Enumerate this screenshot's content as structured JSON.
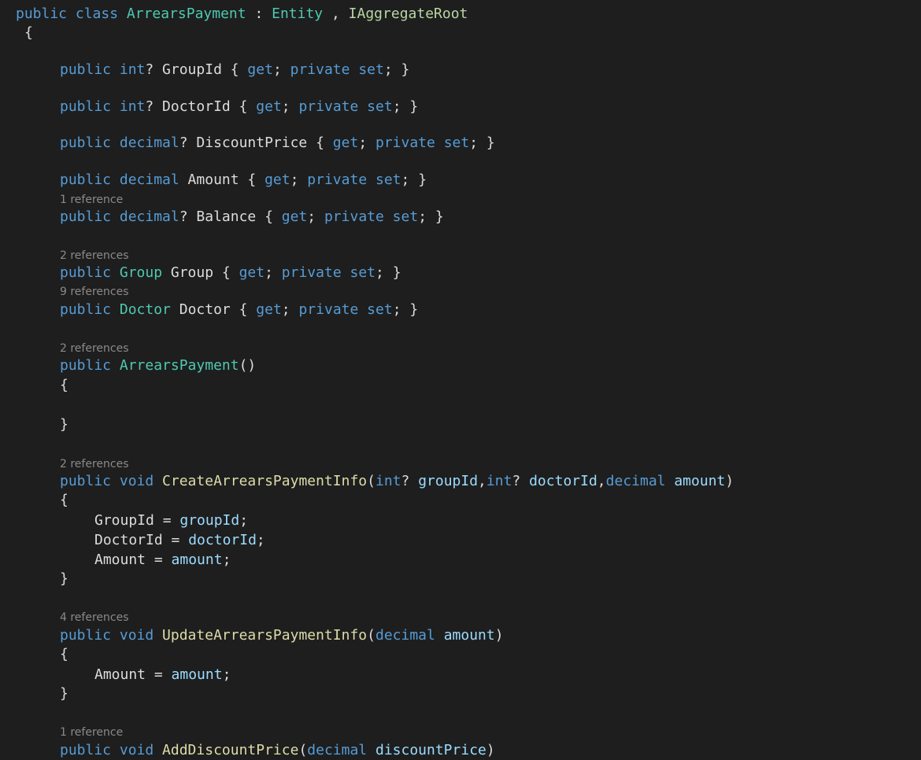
{
  "editor": {
    "colors": {
      "background": "#1e1e1e",
      "keyword": "#569cd6",
      "type": "#4ec9b0",
      "interface": "#b8d7a3",
      "method": "#dcdcaa",
      "parameter": "#9cdcfe",
      "plain": "#dcdcdc",
      "codelens": "#8a8a8a"
    },
    "lines": [
      {
        "tokens": [
          {
            "t": "public class ",
            "c": "kw"
          },
          {
            "t": "ArrearsPayment",
            "c": "type"
          },
          {
            "t": " : ",
            "c": "plain"
          },
          {
            "t": "Entity",
            "c": "type"
          },
          {
            "t": " , ",
            "c": "plain"
          },
          {
            "t": "IAggregateRoot",
            "c": "iface"
          }
        ]
      },
      {
        "tokens": [
          {
            "t": "{",
            "c": "plain"
          }
        ]
      },
      {
        "tokens": [
          {
            "t": "public int",
            "c": "kw"
          },
          {
            "t": "? GroupId { ",
            "c": "plain"
          },
          {
            "t": "get",
            "c": "kw"
          },
          {
            "t": "; ",
            "c": "plain"
          },
          {
            "t": "private set",
            "c": "kw"
          },
          {
            "t": "; }",
            "c": "plain"
          }
        ]
      },
      {
        "tokens": [
          {
            "t": "public int",
            "c": "kw"
          },
          {
            "t": "? DoctorId { ",
            "c": "plain"
          },
          {
            "t": "get",
            "c": "kw"
          },
          {
            "t": "; ",
            "c": "plain"
          },
          {
            "t": "private set",
            "c": "kw"
          },
          {
            "t": "; }",
            "c": "plain"
          }
        ]
      },
      {
        "tokens": [
          {
            "t": "public decimal",
            "c": "kw"
          },
          {
            "t": "? DiscountPrice { ",
            "c": "plain"
          },
          {
            "t": "get",
            "c": "kw"
          },
          {
            "t": "; ",
            "c": "plain"
          },
          {
            "t": "private set",
            "c": "kw"
          },
          {
            "t": "; }",
            "c": "plain"
          }
        ]
      },
      {
        "tokens": [
          {
            "t": "public decimal",
            "c": "kw"
          },
          {
            "t": " Amount { ",
            "c": "plain"
          },
          {
            "t": "get",
            "c": "kw"
          },
          {
            "t": "; ",
            "c": "plain"
          },
          {
            "t": "private set",
            "c": "kw"
          },
          {
            "t": "; }",
            "c": "plain"
          }
        ]
      },
      {
        "tokens": [
          {
            "t": "public decimal",
            "c": "kw"
          },
          {
            "t": "? Balance { ",
            "c": "plain"
          },
          {
            "t": "get",
            "c": "kw"
          },
          {
            "t": "; ",
            "c": "plain"
          },
          {
            "t": "private set",
            "c": "kw"
          },
          {
            "t": "; }",
            "c": "plain"
          }
        ]
      },
      {
        "tokens": [
          {
            "t": "public ",
            "c": "kw"
          },
          {
            "t": "Group",
            "c": "type"
          },
          {
            "t": " Group { ",
            "c": "plain"
          },
          {
            "t": "get",
            "c": "kw"
          },
          {
            "t": "; ",
            "c": "plain"
          },
          {
            "t": "private set",
            "c": "kw"
          },
          {
            "t": "; }",
            "c": "plain"
          }
        ]
      },
      {
        "tokens": [
          {
            "t": "public ",
            "c": "kw"
          },
          {
            "t": "Doctor",
            "c": "type"
          },
          {
            "t": " Doctor { ",
            "c": "plain"
          },
          {
            "t": "get",
            "c": "kw"
          },
          {
            "t": "; ",
            "c": "plain"
          },
          {
            "t": "private set",
            "c": "kw"
          },
          {
            "t": "; }",
            "c": "plain"
          }
        ]
      },
      {
        "tokens": [
          {
            "t": "public ",
            "c": "kw"
          },
          {
            "t": "ArrearsPayment",
            "c": "type"
          },
          {
            "t": "()",
            "c": "plain"
          }
        ]
      },
      {
        "tokens": [
          {
            "t": "{",
            "c": "plain"
          }
        ]
      },
      {
        "tokens": [
          {
            "t": "}",
            "c": "plain"
          }
        ]
      },
      {
        "tokens": [
          {
            "t": "public void ",
            "c": "kw"
          },
          {
            "t": "CreateArrearsPaymentInfo",
            "c": "method"
          },
          {
            "t": "(",
            "c": "plain"
          },
          {
            "t": "int",
            "c": "kw"
          },
          {
            "t": "? ",
            "c": "plain"
          },
          {
            "t": "groupId",
            "c": "param"
          },
          {
            "t": ",",
            "c": "plain"
          },
          {
            "t": "int",
            "c": "kw"
          },
          {
            "t": "? ",
            "c": "plain"
          },
          {
            "t": "doctorId",
            "c": "param"
          },
          {
            "t": ",",
            "c": "plain"
          },
          {
            "t": "decimal ",
            "c": "kw"
          },
          {
            "t": "amount",
            "c": "param"
          },
          {
            "t": ")",
            "c": "plain"
          }
        ]
      },
      {
        "tokens": [
          {
            "t": "{",
            "c": "plain"
          }
        ]
      },
      {
        "tokens": [
          {
            "t": "GroupId = ",
            "c": "plain"
          },
          {
            "t": "groupId",
            "c": "param"
          },
          {
            "t": ";",
            "c": "plain"
          }
        ]
      },
      {
        "tokens": [
          {
            "t": "DoctorId = ",
            "c": "plain"
          },
          {
            "t": "doctorId",
            "c": "param"
          },
          {
            "t": ";",
            "c": "plain"
          }
        ]
      },
      {
        "tokens": [
          {
            "t": "Amount = ",
            "c": "plain"
          },
          {
            "t": "amount",
            "c": "param"
          },
          {
            "t": ";",
            "c": "plain"
          }
        ]
      },
      {
        "tokens": [
          {
            "t": "}",
            "c": "plain"
          }
        ]
      },
      {
        "tokens": [
          {
            "t": "public void ",
            "c": "kw"
          },
          {
            "t": "UpdateArrearsPaymentInfo",
            "c": "method"
          },
          {
            "t": "(",
            "c": "plain"
          },
          {
            "t": "decimal ",
            "c": "kw"
          },
          {
            "t": "amount",
            "c": "param"
          },
          {
            "t": ")",
            "c": "plain"
          }
        ]
      },
      {
        "tokens": [
          {
            "t": "{",
            "c": "plain"
          }
        ]
      },
      {
        "tokens": [
          {
            "t": "Amount = ",
            "c": "plain"
          },
          {
            "t": "amount",
            "c": "param"
          },
          {
            "t": ";",
            "c": "plain"
          }
        ]
      },
      {
        "tokens": [
          {
            "t": "}",
            "c": "plain"
          }
        ]
      },
      {
        "tokens": [
          {
            "t": "public void ",
            "c": "kw"
          },
          {
            "t": "AddDiscountPrice",
            "c": "method"
          },
          {
            "t": "(",
            "c": "plain"
          },
          {
            "t": "decimal ",
            "c": "kw"
          },
          {
            "t": "discountPrice",
            "c": "param"
          },
          {
            "t": ")",
            "c": "plain"
          }
        ]
      }
    ],
    "codelens": [
      "1 reference",
      "2 references",
      "9 references",
      "2 references",
      "2 references",
      "4 references",
      "1 reference"
    ]
  }
}
